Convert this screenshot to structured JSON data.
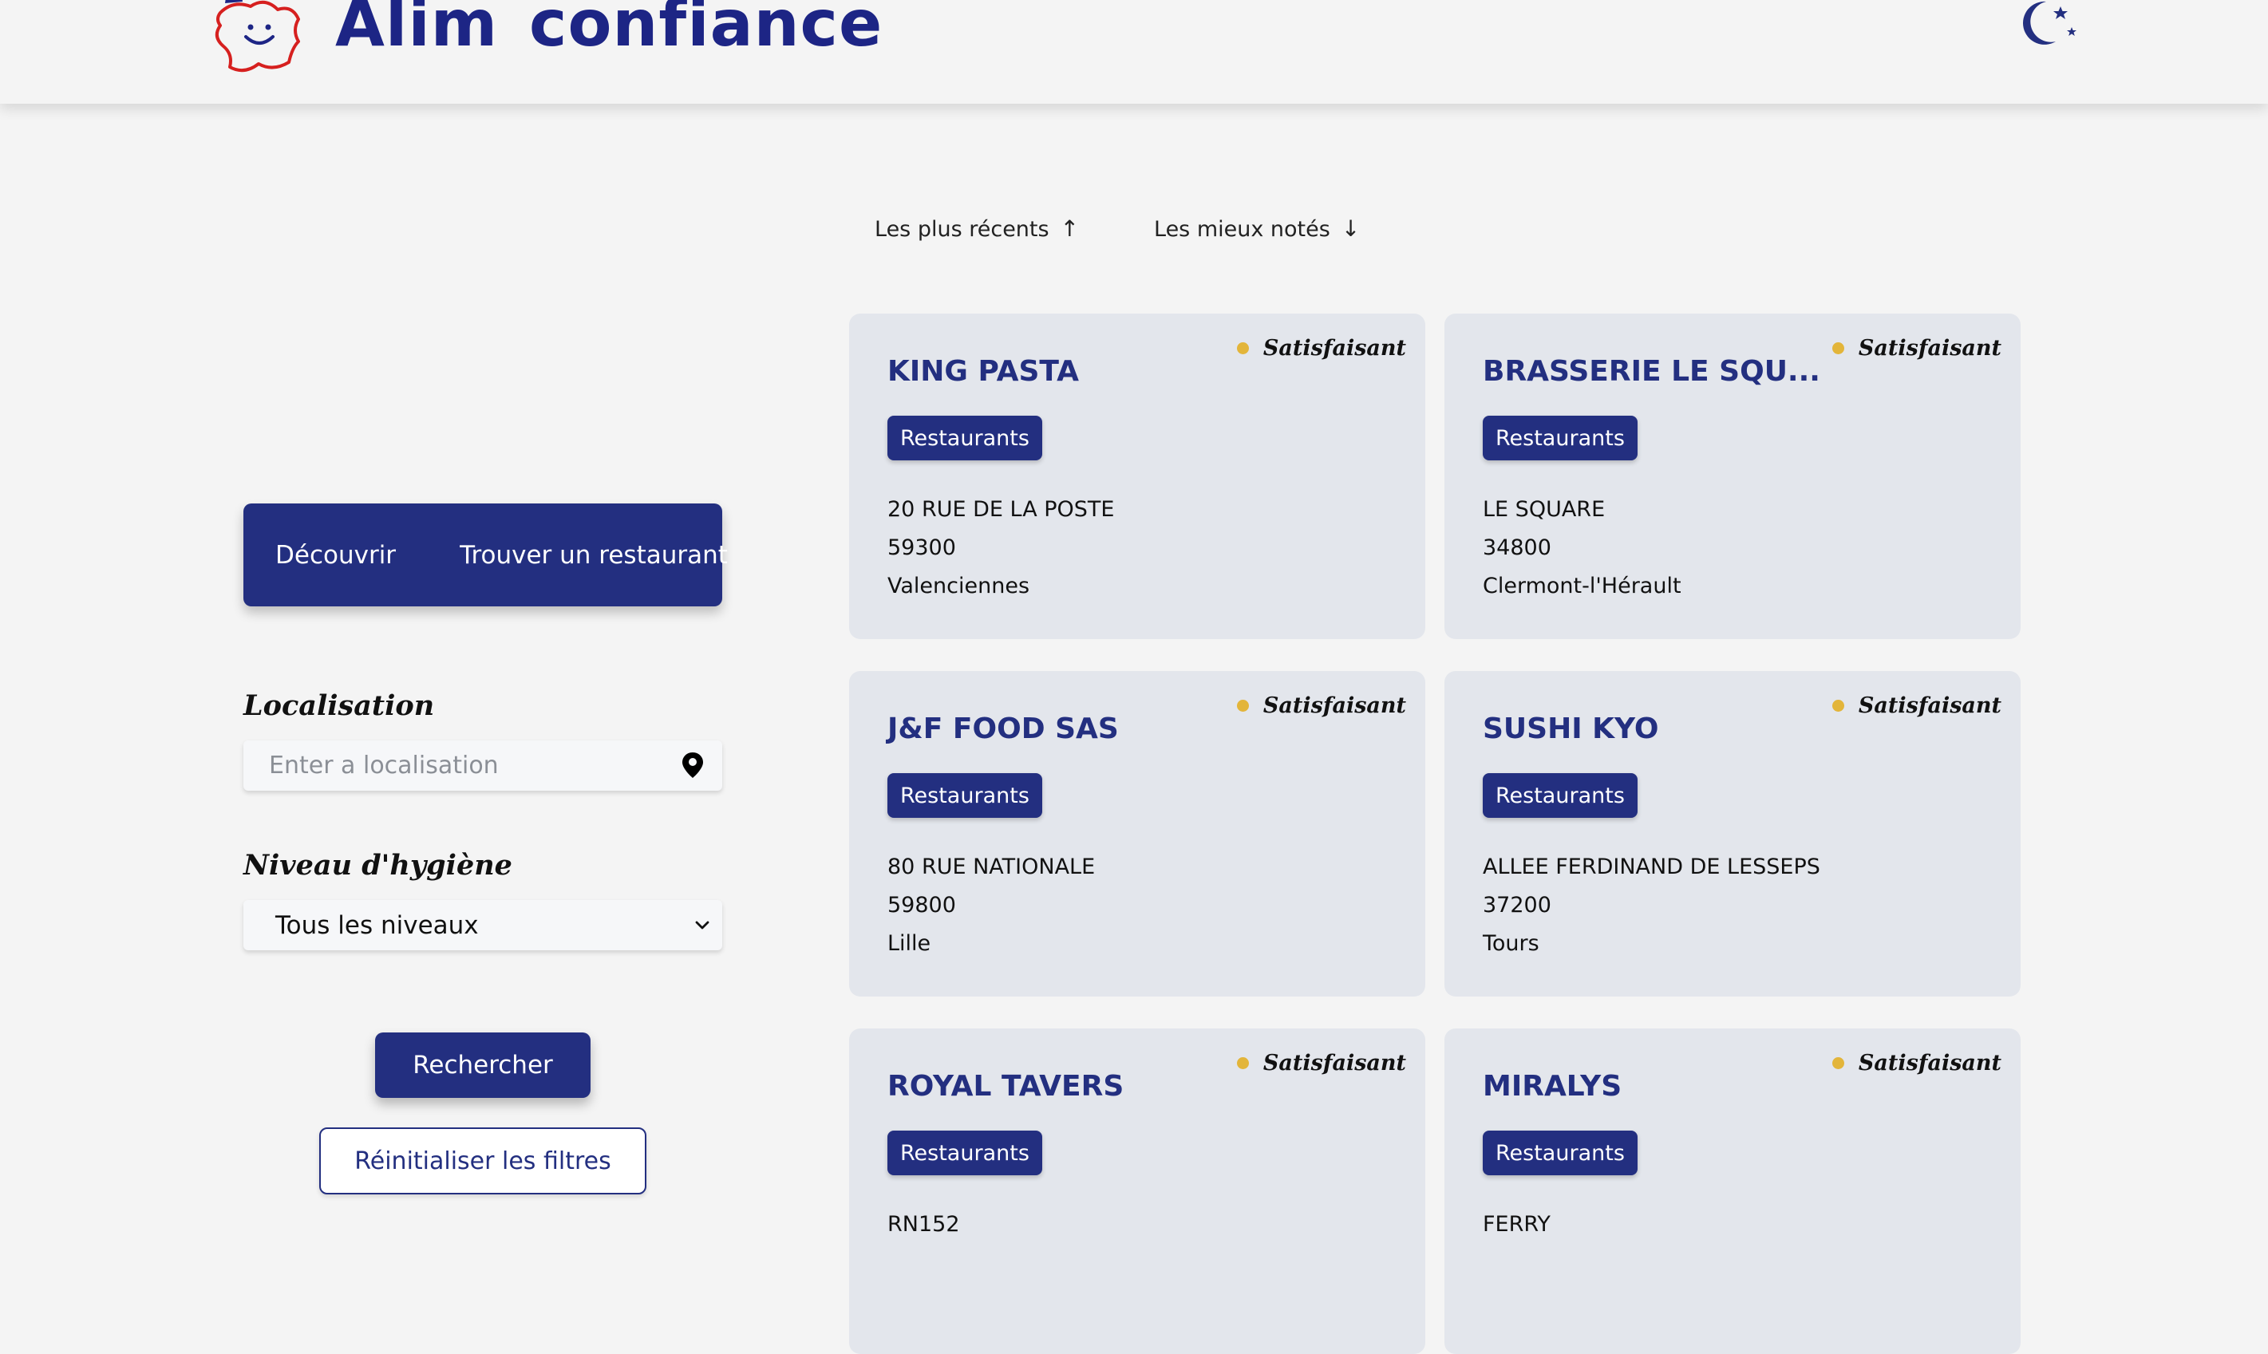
{
  "brand": {
    "name_part1": "Alim",
    "apostrophe": "’",
    "name_part2": "confiance"
  },
  "sort": {
    "recent_label": "Les plus récents",
    "recent_arrow": "↑",
    "rated_label": "Les mieux notés",
    "rated_arrow": "↓"
  },
  "sidebar": {
    "tabs": [
      {
        "label": "Découvrir"
      },
      {
        "label": "Trouver un restaurant"
      }
    ],
    "location_label": "Localisation",
    "location_placeholder": "Enter a localisation",
    "hygiene_label": "Niveau d'hygiène",
    "hygiene_selected": "Tous les niveaux",
    "search_button": "Rechercher",
    "reset_button": "Réinitialiser les filtres"
  },
  "colors": {
    "primary": "#232f80",
    "status_dot": "#e3b53a",
    "accent_red": "#d6201f"
  },
  "results": [
    {
      "name": "KING PASTA",
      "status": "Satisfaisant",
      "category": "Restaurants",
      "street": "20 RUE DE LA POSTE",
      "postcode": "59300",
      "city": "Valenciennes"
    },
    {
      "name": "BRASSERIE LE SQU...",
      "status": "Satisfaisant",
      "category": "Restaurants",
      "street": "LE SQUARE",
      "postcode": "34800",
      "city": "Clermont-l'Hérault"
    },
    {
      "name": "J&F FOOD SAS",
      "status": "Satisfaisant",
      "category": "Restaurants",
      "street": "80 RUE NATIONALE",
      "postcode": "59800",
      "city": "Lille"
    },
    {
      "name": "SUSHI KYO",
      "status": "Satisfaisant",
      "category": "Restaurants",
      "street": "ALLEE FERDINAND DE LESSEPS",
      "postcode": "37200",
      "city": "Tours"
    },
    {
      "name": "ROYAL TAVERS",
      "status": "Satisfaisant",
      "category": "Restaurants",
      "street": "RN152",
      "postcode": "",
      "city": ""
    },
    {
      "name": "MIRALYS",
      "status": "Satisfaisant",
      "category": "Restaurants",
      "street": "FERRY",
      "postcode": "",
      "city": ""
    }
  ]
}
